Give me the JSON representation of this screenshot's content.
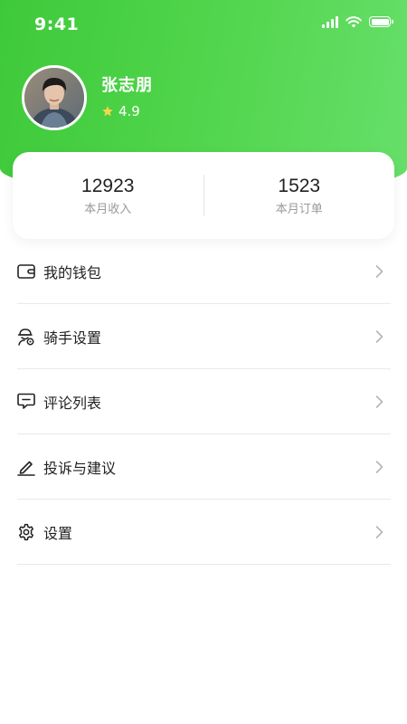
{
  "status_bar": {
    "time": "9:41"
  },
  "profile": {
    "name": "张志朋",
    "rating": "4.9"
  },
  "stats": [
    {
      "value": "12923",
      "label": "本月收入"
    },
    {
      "value": "1523",
      "label": "本月订单"
    }
  ],
  "menu": {
    "items": [
      {
        "label": "我的钱包",
        "icon": "wallet-icon"
      },
      {
        "label": "骑手设置",
        "icon": "rider-settings-icon"
      },
      {
        "label": "评论列表",
        "icon": "comment-icon"
      },
      {
        "label": "投诉与建议",
        "icon": "pen-icon"
      },
      {
        "label": "设置",
        "icon": "gear-icon"
      }
    ]
  },
  "colors": {
    "brand_green": "#4fd44a",
    "star": "#f7d54a"
  }
}
